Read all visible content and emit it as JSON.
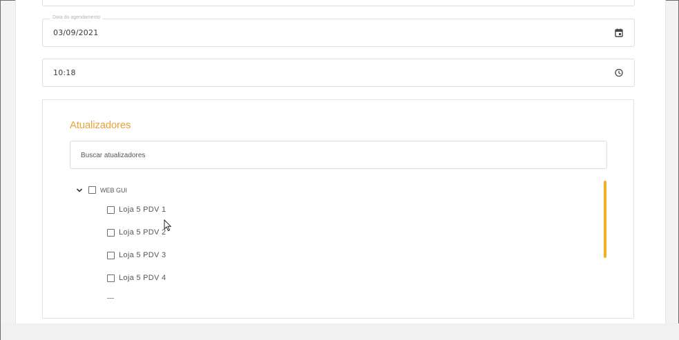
{
  "form": {
    "date_label": "Data do agendamento",
    "date_value": "03/09/2021",
    "time_value": "10:18",
    "date_icon": "calendar-icon",
    "time_icon": "clock-icon"
  },
  "updaters": {
    "title": "Atualizadores",
    "search_placeholder": "Buscar atualizadores",
    "root": {
      "label": "WEB GUI",
      "expanded": true,
      "checked": false
    },
    "items": [
      {
        "label": "Loja 5 PDV 1",
        "checked": false
      },
      {
        "label": "Loja 5 PDV 2",
        "checked": false
      },
      {
        "label": "Loja 5 PDV 3",
        "checked": false
      },
      {
        "label": "Loja 5 PDV 4",
        "checked": false
      }
    ]
  },
  "colors": {
    "accent": "#e8a33a",
    "scrollbar": "#f0b323"
  }
}
